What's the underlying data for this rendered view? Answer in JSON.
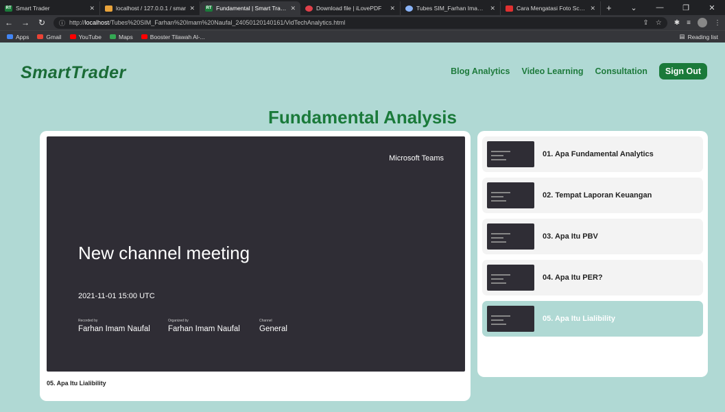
{
  "browser": {
    "tabs": [
      {
        "title": "Smart Trader",
        "fav": "RT",
        "color": "#1a7a3a",
        "active": false
      },
      {
        "title": "localhost / 127.0.0.1 / smar",
        "fav": "",
        "color": "#e8a33b",
        "active": false
      },
      {
        "title": "Fundamental | Smart Trader",
        "fav": "RT",
        "color": "#1a7a3a",
        "active": true
      },
      {
        "title": "Download file | iLovePDF",
        "fav": "",
        "color": "#e0404a",
        "active": false
      },
      {
        "title": "Tubes SIM_Farhan Imam N",
        "fav": "",
        "color": "#8ab4f8",
        "active": false
      },
      {
        "title": "Cara Mengatasi Foto Scree",
        "fav": "",
        "color": "#e03030",
        "active": false
      }
    ],
    "url_prefix": "http://",
    "url_host": "localhost",
    "url_path": "/Tubes%20SIM_Farhan%20Imam%20Naufal_24050120140161/VidTechAnalytics.html",
    "bookmarks": [
      {
        "label": "Apps",
        "color": "#4285f4"
      },
      {
        "label": "Gmail",
        "color": "#ea4335"
      },
      {
        "label": "YouTube",
        "color": "#ff0000"
      },
      {
        "label": "Maps",
        "color": "#34a853"
      },
      {
        "label": "Booster Tilawah Al-...",
        "color": "#ff0000"
      }
    ],
    "reading_list": "Reading list"
  },
  "site": {
    "logo": "SmartTrader",
    "nav": [
      "Blog Analytics",
      "Video Learning",
      "Consultation"
    ],
    "signout": "Sign Out"
  },
  "heading": "Fundamental Analysis",
  "video": {
    "app": "Microsoft Teams",
    "meeting_title": "New channel meeting",
    "date": "2021-11-01 15:00 UTC",
    "meta": [
      {
        "label": "Recorded by",
        "value": "Farhan Imam Naufal"
      },
      {
        "label": "Organized by",
        "value": "Farhan Imam Naufal"
      },
      {
        "label": "Channel",
        "value": "General"
      }
    ],
    "caption": "05. Apa Itu Lialibility"
  },
  "playlist": [
    {
      "title": "01. Apa Fundamental Analytics",
      "active": false
    },
    {
      "title": "02. Tempat Laporan Keuangan",
      "active": false
    },
    {
      "title": "03. Apa Itu PBV",
      "active": false
    },
    {
      "title": "04. Apa Itu PER?",
      "active": false
    },
    {
      "title": "05. Apa Itu Lialibility",
      "active": true
    }
  ]
}
